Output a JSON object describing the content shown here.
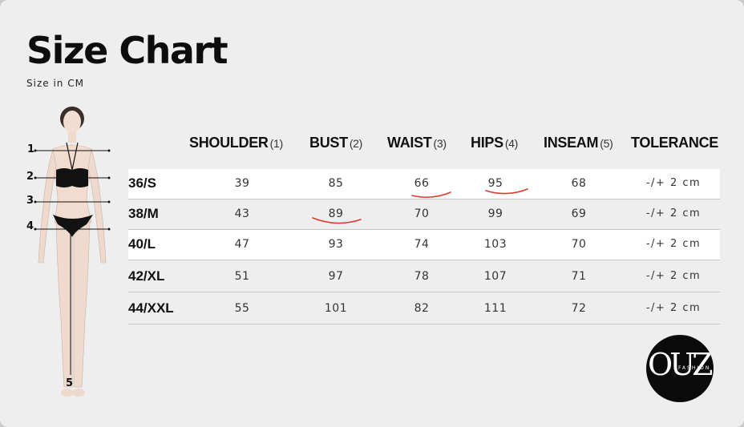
{
  "title": "Size Chart",
  "subtitle": "Size in CM",
  "figure_labels": [
    "1",
    "2",
    "3",
    "4",
    "5"
  ],
  "columns": [
    {
      "label": "SHOULDER",
      "num": "(1)"
    },
    {
      "label": "BUST",
      "num": "(2)"
    },
    {
      "label": "WAIST",
      "num": "(3)"
    },
    {
      "label": "HIPS",
      "num": "(4)"
    },
    {
      "label": "INSEAM",
      "num": "(5)"
    },
    {
      "label": "TOLERANCE",
      "num": ""
    }
  ],
  "rows": [
    {
      "size": "36/S",
      "shoulder": "39",
      "bust": "85",
      "waist": "66",
      "hips": "95",
      "inseam": "68",
      "tolerance": "-/+ 2 cm"
    },
    {
      "size": "38/M",
      "shoulder": "43",
      "bust": "89",
      "waist": "70",
      "hips": "99",
      "inseam": "69",
      "tolerance": "-/+ 2 cm"
    },
    {
      "size": "40/L",
      "shoulder": "47",
      "bust": "93",
      "waist": "74",
      "hips": "103",
      "inseam": "70",
      "tolerance": "-/+ 2 cm"
    },
    {
      "size": "42/XL",
      "shoulder": "51",
      "bust": "97",
      "waist": "78",
      "hips": "107",
      "inseam": "71",
      "tolerance": "-/+ 2 cm"
    },
    {
      "size": "44/XXL",
      "shoulder": "55",
      "bust": "101",
      "waist": "82",
      "hips": "111",
      "inseam": "72",
      "tolerance": "-/+ 2 cm"
    }
  ],
  "logo": {
    "text": "OUZ",
    "sub": "FASHION"
  },
  "colors": {
    "annotation": "#e0372f",
    "background": "#eeeeee",
    "logo_bg": "#0b0b0b"
  }
}
